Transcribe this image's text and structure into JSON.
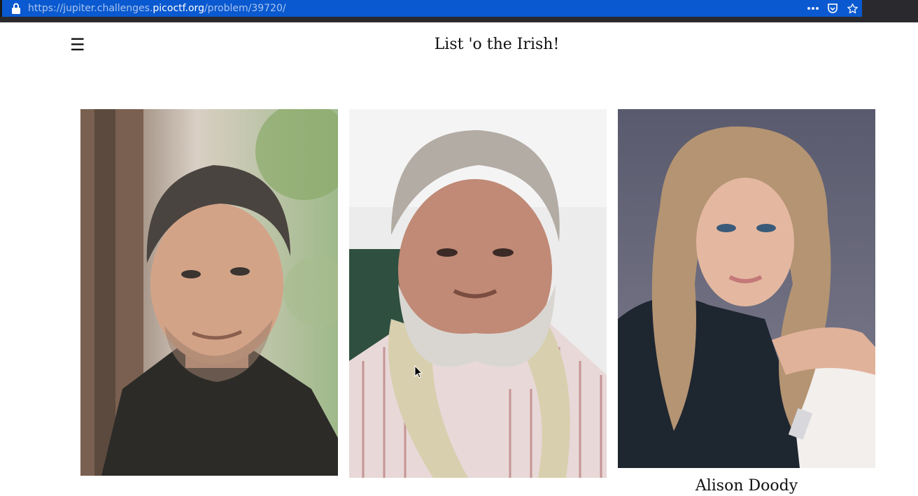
{
  "browser": {
    "url_prefix": "https://jupiter.challenges.",
    "url_domain": "picoctf.org",
    "url_path": "/problem/39720/",
    "icons": [
      "lock-icon",
      "more-icon",
      "pocket-icon",
      "bookmark-star-icon"
    ]
  },
  "header": {
    "menu_glyph": "☰",
    "title": "List 'o the Irish!"
  },
  "people": [
    {
      "name": "",
      "photo": "man-dark-hair-photo"
    },
    {
      "name": "",
      "photo": "bearded-man-photo"
    },
    {
      "name": "Alison Doody",
      "photo": "blonde-woman-photo"
    }
  ],
  "colors": {
    "urlbar": "#0a59d0",
    "chrome": "#2a2a2e",
    "page_bg": "#ffffff"
  }
}
